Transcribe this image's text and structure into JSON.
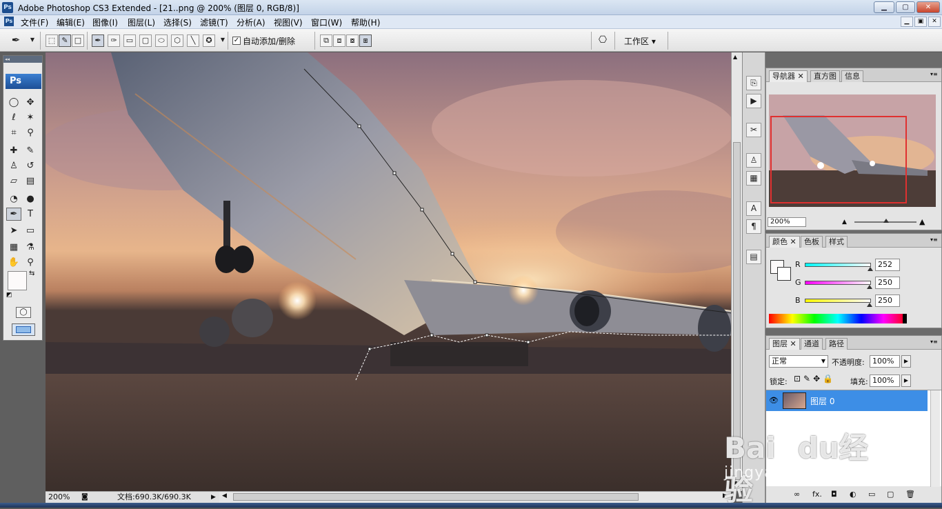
{
  "window": {
    "title": "Adobe Photoshop CS3 Extended - [21..png @ 200% (图层 0, RGB/8)]",
    "app_icon": "Ps",
    "controls": {
      "minimize": "▁",
      "maximize": "▢",
      "close": "✕"
    }
  },
  "menu": {
    "items": [
      "文件(F)",
      "编辑(E)",
      "图像(I)",
      "图层(L)",
      "选择(S)",
      "滤镜(T)",
      "分析(A)",
      "视图(V)",
      "窗口(W)",
      "帮助(H)"
    ],
    "doc_controls": {
      "minimize": "▁",
      "restore": "▣",
      "close": "✕"
    }
  },
  "options_bar": {
    "auto_add_delete_label": "自动添加/删除",
    "auto_add_delete_checked": true,
    "workspace_label": "工作区 ▾"
  },
  "toolbox": {
    "header": "◂◂",
    "logo": "Ps",
    "tools": [
      {
        "name": "marquee-tool",
        "glyph": "◯"
      },
      {
        "name": "move-tool",
        "glyph": "✥"
      },
      {
        "name": "lasso-tool",
        "glyph": "ℓ"
      },
      {
        "name": "magic-wand-tool",
        "glyph": "✶"
      },
      {
        "name": "crop-tool",
        "glyph": "⌗"
      },
      {
        "name": "eyedropper-slice-tool",
        "glyph": "⚲"
      },
      {
        "name": "healing-brush-tool",
        "glyph": "✚"
      },
      {
        "name": "brush-tool",
        "glyph": "✎"
      },
      {
        "name": "clone-stamp-tool",
        "glyph": "♙"
      },
      {
        "name": "history-brush-tool",
        "glyph": "↺"
      },
      {
        "name": "eraser-tool",
        "glyph": "▱"
      },
      {
        "name": "gradient-tool",
        "glyph": "▤"
      },
      {
        "name": "blur-tool",
        "glyph": "◔"
      },
      {
        "name": "dodge-tool",
        "glyph": "●"
      },
      {
        "name": "pen-tool",
        "glyph": "✒"
      },
      {
        "name": "type-tool",
        "glyph": "T"
      },
      {
        "name": "path-select-tool",
        "glyph": "➤"
      },
      {
        "name": "shape-tool",
        "glyph": "▭"
      },
      {
        "name": "notes-tool",
        "glyph": "▦"
      },
      {
        "name": "eyedropper-tool",
        "glyph": "⚗"
      },
      {
        "name": "hand-tool",
        "glyph": "✋"
      },
      {
        "name": "zoom-tool",
        "glyph": "⚲"
      }
    ]
  },
  "status": {
    "zoom": "200%",
    "doc_info": "文档:690.3K/690.3K"
  },
  "navigator": {
    "tabs": [
      "导航器",
      "直方图",
      "信息"
    ],
    "zoom": "200%"
  },
  "color_panel": {
    "tabs": [
      "颜色",
      "色板",
      "样式"
    ],
    "channels": [
      {
        "label": "R",
        "value": "252",
        "gradient": "linear-gradient(90deg,#00fafa,#fcfafa)"
      },
      {
        "label": "G",
        "value": "250",
        "gradient": "linear-gradient(90deg,#fc00fa,#fcfafa)"
      },
      {
        "label": "B",
        "value": "250",
        "gradient": "linear-gradient(90deg,#fcfa00,#fcfafa)"
      }
    ],
    "foreground": "#fcfafa"
  },
  "layers_panel": {
    "tabs": [
      "图层",
      "通道",
      "路径"
    ],
    "blend_mode": "正常",
    "opacity_label": "不透明度:",
    "opacity": "100%",
    "lock_label": "锁定:",
    "fill_label": "填充:",
    "fill": "100%",
    "layer_name": "图层 0",
    "footer_icons": [
      "∞",
      "fx.",
      "◘",
      "◐",
      "▭",
      "▢",
      "🗑"
    ]
  },
  "watermark": {
    "brand": "Bai",
    "brand2": "du",
    "cn": "经验",
    "url": "jingyan.baidu.com"
  },
  "colors": {
    "accent": "#3399ff",
    "selection_blue": "#3d8ee6"
  }
}
